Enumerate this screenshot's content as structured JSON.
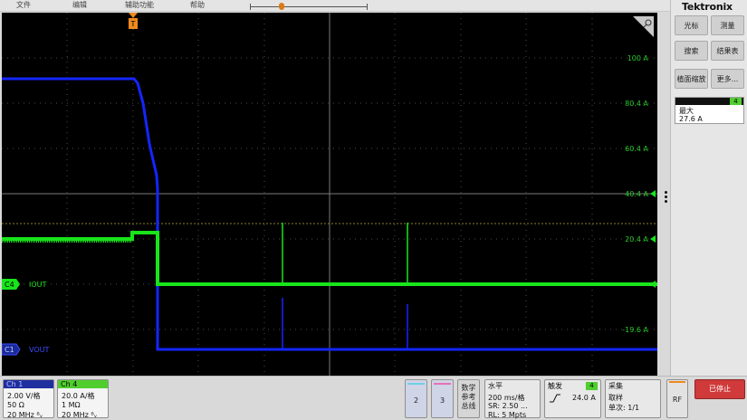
{
  "menu": {
    "items": [
      "文件",
      "编辑",
      "辅助功能",
      "帮助"
    ]
  },
  "brand": "Tektronix",
  "right_panel": {
    "buttons": [
      {
        "label": "光标"
      },
      {
        "label": "测量"
      },
      {
        "label": "搜索"
      },
      {
        "label": "结果表"
      },
      {
        "label": "植面缩放"
      },
      {
        "label": "更多..."
      }
    ],
    "measure": {
      "channel": "4",
      "label": "最大",
      "value": "27.6 A"
    }
  },
  "screen": {
    "trigger_marker": "T",
    "right_scale": [
      "100 A",
      "80.4 A",
      "60.4 A",
      "40.4 A",
      "20.4 A",
      "-19.6 A"
    ],
    "ch4_label": "IOUT",
    "ch4_marker": "C4",
    "ch1_label": "VOUT",
    "ch1_marker": "C1",
    "colors": {
      "ch1": "#1426ff",
      "ch4": "#18e51a",
      "grid": "#5a5a5a",
      "trigger": "#ef8a1e"
    }
  },
  "bottom": {
    "ch1": {
      "header": "Ch 1",
      "lines": [
        "2.00 V/格",
        "50 Ω",
        "20 MHz ᴮᵥ"
      ]
    },
    "ch4": {
      "header": "Ch 4",
      "lines": [
        "20.0 A/格",
        "1 MΩ",
        "20 MHz ᴮᵥ"
      ]
    },
    "add2": "2",
    "add3": "3",
    "math": [
      "数学",
      "参考",
      "总线"
    ],
    "horizontal": {
      "title": "水平",
      "lines": [
        "200 ms/格",
        "SR: 2.50 ...",
        "RL: 5 Mpts"
      ]
    },
    "trigger": {
      "title": "触发",
      "channel": "4",
      "value": "24.0 A"
    },
    "acquire": {
      "title": "采集",
      "lines": [
        "取样",
        "单次: 1/1"
      ]
    },
    "rf": "RF",
    "stop": "已停止"
  }
}
